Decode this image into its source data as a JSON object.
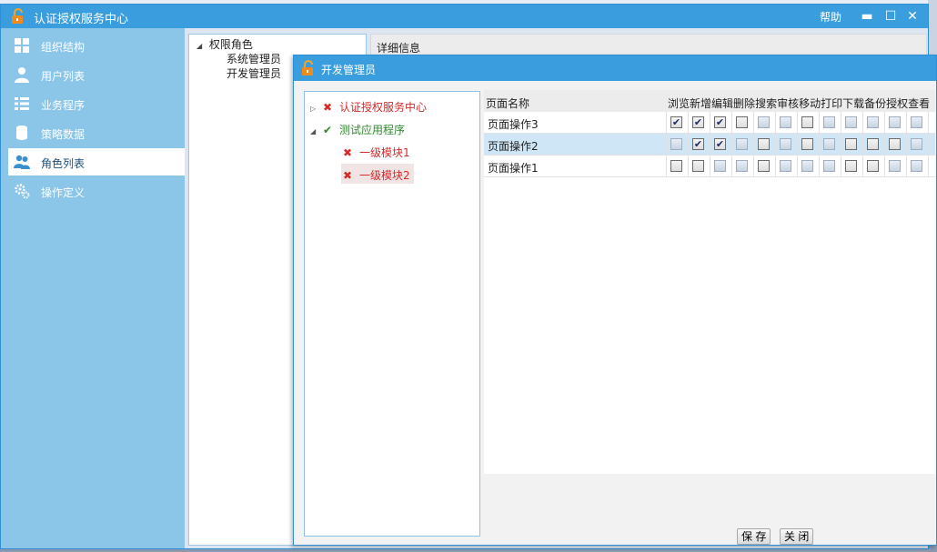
{
  "app": {
    "title": "认证授权服务中心",
    "help_label": "帮助",
    "minimize_glyph": "▬",
    "maximize_glyph": "☐",
    "close_glyph": "✕"
  },
  "sidebar": {
    "items": [
      {
        "label": "组织结构",
        "icon": "grid-icon"
      },
      {
        "label": "用户列表",
        "icon": "user-icon"
      },
      {
        "label": "业务程序",
        "icon": "list-icon"
      },
      {
        "label": "策略数据",
        "icon": "database-icon"
      },
      {
        "label": "角色列表",
        "icon": "users-icon",
        "active": true
      },
      {
        "label": "操作定义",
        "icon": "gears-icon"
      }
    ]
  },
  "role_tree": {
    "root": "权限角色",
    "children": [
      "系统管理员",
      "开发管理员"
    ]
  },
  "detail": {
    "header": "详细信息"
  },
  "dialog": {
    "title": "开发管理员",
    "module_tree": [
      {
        "label": "认证授权服务中心",
        "mark": "✖",
        "status": "denied",
        "expander": "▷"
      },
      {
        "label": "测试应用程序",
        "mark": "✔",
        "status": "granted",
        "expander": "◢"
      },
      {
        "label": "一级模块1",
        "mark": "✖",
        "status": "denied"
      },
      {
        "label": "一级模块2",
        "mark": "✖",
        "status": "denied",
        "selected": true
      }
    ],
    "table": {
      "name_header": "页面名称",
      "perm_headers": [
        "浏览",
        "新增",
        "编辑",
        "删除",
        "搜索",
        "审核",
        "移动",
        "打印",
        "下载",
        "备份",
        "授权",
        "查看"
      ],
      "rows": [
        {
          "name": "页面操作3",
          "checked": [
            true,
            true,
            true,
            false,
            false,
            false,
            false,
            false,
            false,
            false,
            false,
            false
          ],
          "disabled": [
            false,
            false,
            false,
            false,
            true,
            true,
            false,
            true,
            true,
            true,
            true,
            true
          ]
        },
        {
          "name": "页面操作2",
          "checked": [
            false,
            true,
            true,
            false,
            false,
            false,
            false,
            false,
            false,
            false,
            false,
            false
          ],
          "disabled": [
            true,
            false,
            false,
            true,
            false,
            true,
            false,
            true,
            false,
            false,
            false,
            true
          ],
          "selected": true
        },
        {
          "name": "页面操作1",
          "checked": [
            false,
            false,
            false,
            false,
            false,
            false,
            false,
            false,
            false,
            false,
            false,
            false
          ],
          "disabled": [
            false,
            false,
            true,
            true,
            false,
            true,
            true,
            true,
            false,
            false,
            true,
            true
          ]
        }
      ]
    },
    "save_label": "保 存",
    "close_label": "关 闭"
  },
  "colors": {
    "titlebar": "#3a9ede",
    "sidebar": "#8bc5e8",
    "denied": "#d42b2b",
    "granted": "#2c8a2c",
    "selected_row": "#cfe6f7"
  }
}
